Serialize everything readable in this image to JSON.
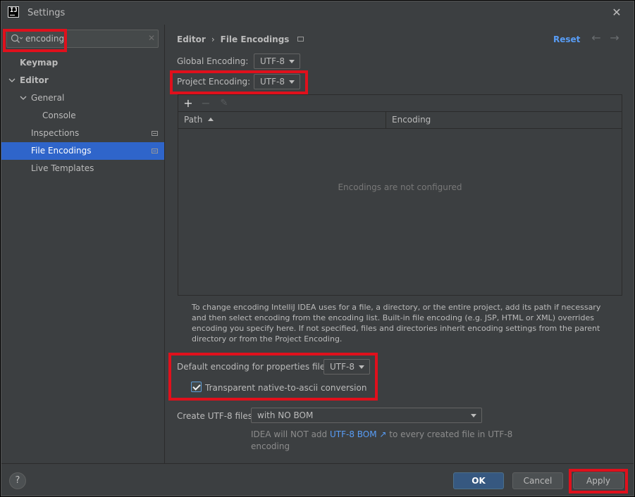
{
  "window": {
    "title": "Settings",
    "app_icon_text": "IJ"
  },
  "search": {
    "value": "encoding",
    "placeholder": ""
  },
  "sidebar": {
    "items": [
      {
        "label": "Keymap"
      },
      {
        "label": "Editor"
      },
      {
        "label": "General"
      },
      {
        "label": "Console"
      },
      {
        "label": "Inspections"
      },
      {
        "label": "File Encodings"
      },
      {
        "label": "Live Templates"
      }
    ]
  },
  "breadcrumb": {
    "parent": "Editor",
    "separator": "›",
    "current": "File Encodings"
  },
  "header": {
    "reset_label": "Reset"
  },
  "global_encoding": {
    "label": "Global Encoding:",
    "value": "UTF-8"
  },
  "project_encoding": {
    "label": "Project Encoding:",
    "value": "UTF-8"
  },
  "table": {
    "toolbar": {
      "add": "+",
      "remove": "−",
      "edit": "✎"
    },
    "columns": [
      "Path",
      "Encoding"
    ],
    "empty_text": "Encodings are not configured"
  },
  "help_text": "To change encoding IntelliJ IDEA uses for a file, a directory, or the entire project, add its path if necessary and then select encoding from the encoding list. Built-in file encoding (e.g. JSP, HTML or XML) overrides encoding you specify here. If not specified, files and directories inherit encoding settings from the parent directory or from the Project Encoding.",
  "properties_encoding": {
    "label": "Default encoding for properties files:",
    "value": "UTF-8"
  },
  "native_to_ascii": {
    "label": "Transparent native-to-ascii conversion",
    "checked": true
  },
  "utf8_files": {
    "label": "Create UTF-8 files:",
    "value": "with NO BOM"
  },
  "bom_hint": {
    "prefix": "IDEA will NOT add ",
    "link": "UTF-8 BOM ↗",
    "suffix": " to every created file in UTF-8 encoding"
  },
  "footer": {
    "help": "?",
    "ok": "OK",
    "cancel": "Cancel",
    "apply": "Apply"
  },
  "colors": {
    "accent": "#2f65ca",
    "link": "#589df6",
    "highlight": "#e0101c",
    "primary_button": "#365880"
  }
}
